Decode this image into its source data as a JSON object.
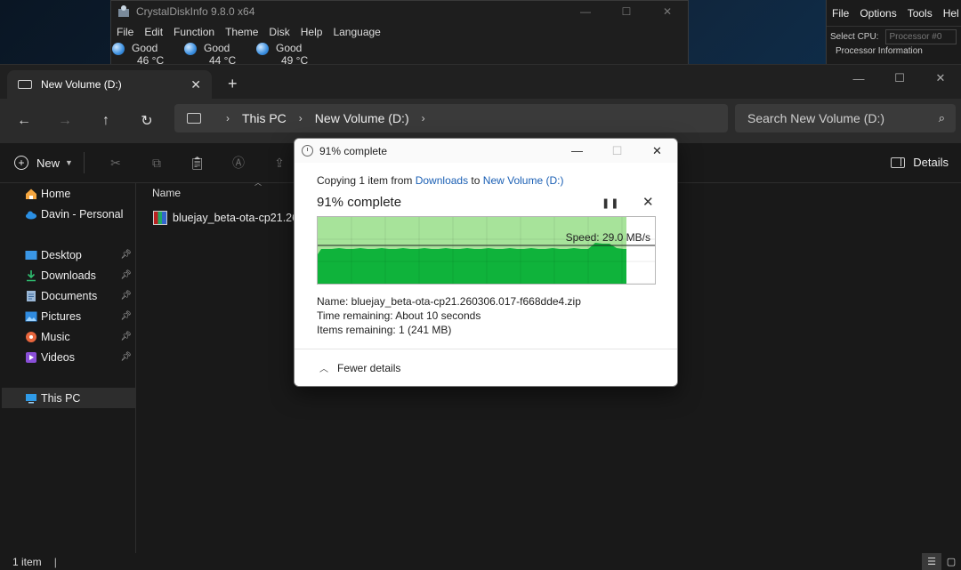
{
  "cdi": {
    "title": "CrystalDiskInfo 9.8.0 x64",
    "menu": [
      "File",
      "Edit",
      "Function",
      "Theme",
      "Disk",
      "Help",
      "Language"
    ],
    "drives": [
      {
        "status": "Good",
        "temp": "46 °C"
      },
      {
        "status": "Good",
        "temp": "44 °C"
      },
      {
        "status": "Good",
        "temp": "49 °C"
      }
    ]
  },
  "hw": {
    "menu": [
      "File",
      "Options",
      "Tools",
      "Hel"
    ],
    "select_label": "Select CPU:",
    "select_value": "Processor #0",
    "section": "Processor Information"
  },
  "explorer": {
    "tab_title": "New Volume (D:)",
    "breadcrumb": [
      "This PC",
      "New Volume (D:)"
    ],
    "search_placeholder": "Search New Volume (D:)",
    "new_label": "New",
    "details_label": "Details",
    "sidebar": [
      {
        "label": "Home",
        "icon": "home-icon",
        "pinned": false
      },
      {
        "label": "Davin - Personal",
        "icon": "onedrive-icon",
        "pinned": false
      },
      {
        "label": "Desktop",
        "icon": "desktop-icon",
        "pinned": true
      },
      {
        "label": "Downloads",
        "icon": "downloads-icon",
        "pinned": true
      },
      {
        "label": "Documents",
        "icon": "documents-icon",
        "pinned": true
      },
      {
        "label": "Pictures",
        "icon": "pictures-icon",
        "pinned": true
      },
      {
        "label": "Music",
        "icon": "music-icon",
        "pinned": true
      },
      {
        "label": "Videos",
        "icon": "videos-icon",
        "pinned": true
      },
      {
        "label": "This PC",
        "icon": "this-pc-icon",
        "pinned": false
      }
    ],
    "column_name": "Name",
    "file_name": "bluejay_beta-ota-cp21.260",
    "status_items": "1 item"
  },
  "dialog": {
    "title": "91% complete",
    "copy_prefix": "Copying 1 item from ",
    "source": "Downloads",
    "to_word": " to ",
    "destination": "New Volume (D:)",
    "percent_label": "91% complete",
    "progress": 0.91,
    "speed": "Speed: 29.0 MB/s",
    "name_line": "Name:  bluejay_beta-ota-cp21.260306.017-f668dde4.zip",
    "time_line": "Time remaining:  About 10 seconds",
    "items_line": "Items remaining:  1 (241 MB)",
    "fewer_details": "Fewer details"
  },
  "colors": {
    "graph_fill": "#0fb33b",
    "graph_bg": "#a7e39a",
    "link": "#1a5fb4"
  }
}
